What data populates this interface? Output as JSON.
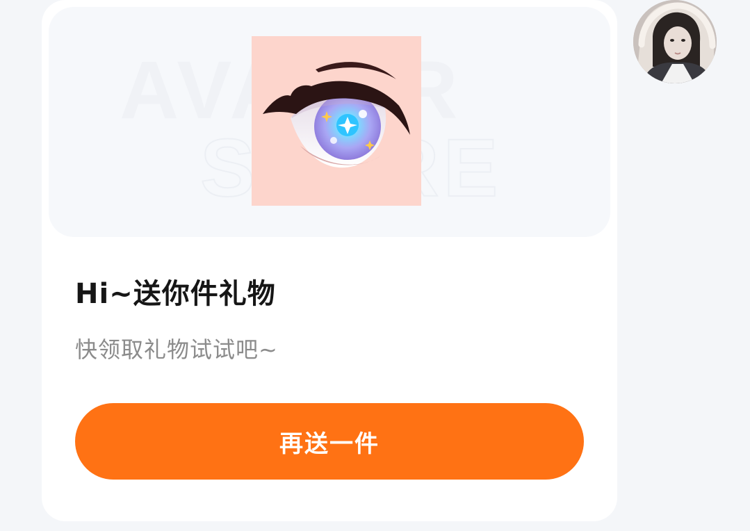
{
  "card": {
    "title": "Hi~送你件礼物",
    "subtitle": "快领取礼物试试吧~",
    "button_label": "再送一件",
    "watermark_line1": "AVATAR",
    "watermark_line2": "STORE",
    "gift_icon": "anime-eye-icon"
  },
  "colors": {
    "accent": "#ff7214",
    "page_bg": "#f4f6f9",
    "card_bg": "#ffffff",
    "banner_bg": "#f6f8fb",
    "gift_bg": "#fdd5cc",
    "title": "#161616",
    "subtitle": "#8b8b8b"
  },
  "avatar": {
    "icon": "user-avatar-photo"
  }
}
